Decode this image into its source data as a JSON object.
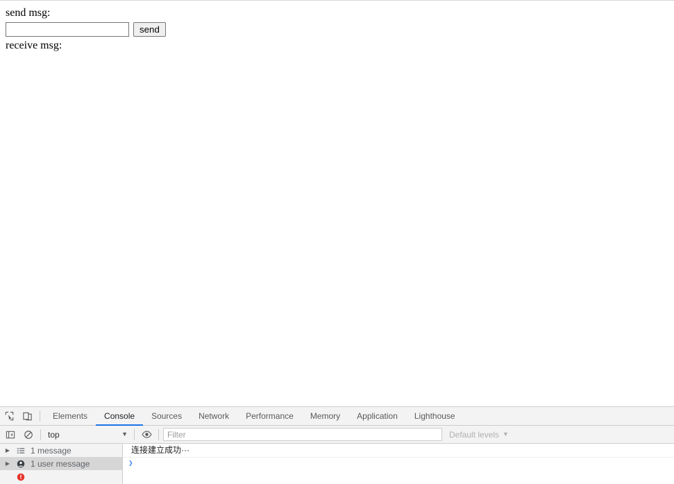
{
  "page": {
    "send_label": "send msg:",
    "input_value": "",
    "input_placeholder": "",
    "send_button_label": "send",
    "receive_label": "receive msg:"
  },
  "devtools": {
    "icons": {
      "inspect": "inspect-element-icon",
      "device": "device-toolbar-icon",
      "sidebar_toggle": "console-sidebar-toggle-icon",
      "clear": "clear-console-icon",
      "eye": "live-expression-eye-icon"
    },
    "tabs": [
      {
        "label": "Elements",
        "active": false
      },
      {
        "label": "Console",
        "active": true
      },
      {
        "label": "Sources",
        "active": false
      },
      {
        "label": "Network",
        "active": false
      },
      {
        "label": "Performance",
        "active": false
      },
      {
        "label": "Memory",
        "active": false
      },
      {
        "label": "Application",
        "active": false
      },
      {
        "label": "Lighthouse",
        "active": false
      }
    ],
    "active_tab_accent": "#1a73e8",
    "filterbar": {
      "context": "top",
      "context_caret": "▼",
      "filter_value": "",
      "filter_placeholder": "Filter",
      "levels_label": "Default levels",
      "levels_caret": "▼"
    },
    "sidebar": {
      "items": [
        {
          "arrow": "▶",
          "icon": "list-icon",
          "label": "1 message",
          "selected": false
        },
        {
          "arrow": "▶",
          "icon": "user-icon",
          "label": "1 user message",
          "selected": true
        },
        {
          "arrow": "▶",
          "icon": "error-circle-icon",
          "label": "",
          "selected": false
        }
      ]
    },
    "console": {
      "messages": [
        {
          "text": "连接建立成功···"
        }
      ],
      "prompt_caret": "❯"
    }
  }
}
